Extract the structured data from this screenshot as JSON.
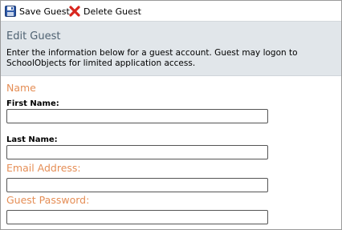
{
  "toolbar": {
    "save_label": "Save Guest",
    "delete_label": "Delete Guest",
    "save_icon": "floppy-disk-icon",
    "delete_icon": "red-x-icon"
  },
  "header": {
    "title": "Edit Guest",
    "description": "Enter the information below for a guest account. Guest may logon to SchoolObjects for limited application access."
  },
  "form": {
    "name_section": "Name",
    "first_name_label": "First Name:",
    "first_name_value": "",
    "last_name_label": "Last Name:",
    "last_name_value": "",
    "email_section": "Email Address:",
    "email_value": "",
    "password_section": "Guest Password:",
    "password_value": ""
  },
  "colors": {
    "section_heading": "#e58e56",
    "header_background": "#e1e6ea",
    "title_text": "#4f6272"
  }
}
